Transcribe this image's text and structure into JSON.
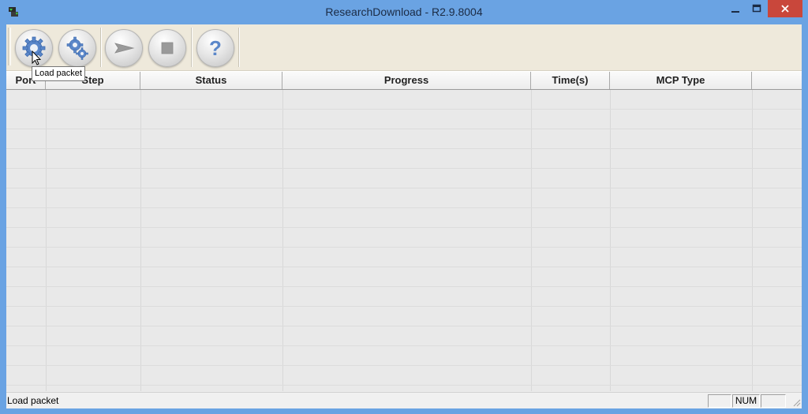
{
  "window": {
    "title": "ResearchDownload - R2.9.8004",
    "minimize_icon": "minimize-icon",
    "maximize_icon": "maximize-icon",
    "close_icon": "close-icon"
  },
  "toolbar": {
    "buttons": [
      {
        "name": "load-packet-button",
        "icon": "gear-icon"
      },
      {
        "name": "settings-button",
        "icon": "gears-icon"
      },
      {
        "name": "start-download-button",
        "icon": "play-arrow-icon"
      },
      {
        "name": "stop-download-button",
        "icon": "stop-icon"
      },
      {
        "name": "help-button",
        "icon": "question-icon"
      }
    ]
  },
  "tooltip": "Load packet",
  "list": {
    "columns": [
      "Port",
      "Step",
      "Status",
      "Progress",
      "Time(s)",
      "MCP Type"
    ]
  },
  "statusbar": {
    "text": "Load packet",
    "num_indicator": "NUM"
  }
}
